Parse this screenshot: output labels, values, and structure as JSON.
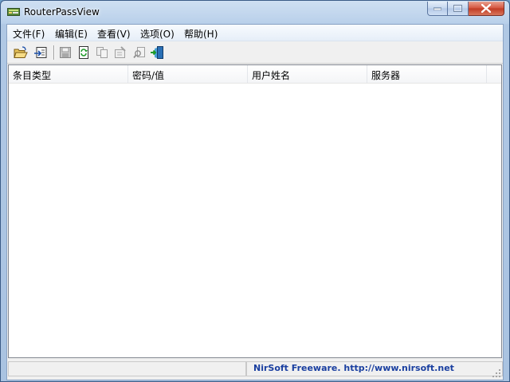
{
  "window": {
    "title": "RouterPassView"
  },
  "menu": [
    {
      "label": "文件(F)"
    },
    {
      "label": "编辑(E)"
    },
    {
      "label": "查看(V)"
    },
    {
      "label": "选项(O)"
    },
    {
      "label": "帮助(H)"
    }
  ],
  "toolbar": [
    {
      "icon": "open-folder-icon",
      "enabled": true
    },
    {
      "icon": "open-config-icon",
      "enabled": true
    },
    {
      "icon": "save-icon",
      "enabled": false
    },
    {
      "icon": "refresh-icon",
      "enabled": true
    },
    {
      "icon": "copy-icon",
      "enabled": false
    },
    {
      "icon": "properties-icon",
      "enabled": false
    },
    {
      "icon": "find-icon",
      "enabled": false
    },
    {
      "icon": "exit-icon",
      "enabled": true
    }
  ],
  "list": {
    "columns": [
      {
        "label": "条目类型"
      },
      {
        "label": "密码/值"
      },
      {
        "label": "用户姓名"
      },
      {
        "label": "服务器"
      }
    ],
    "rows": []
  },
  "status": {
    "link_text": "NirSoft Freeware.  http://www.nirsoft.net"
  },
  "colors": {
    "title_gradient": "#b9d0ea",
    "close_button": "#c7432b",
    "status_link": "#1a3fa0"
  }
}
